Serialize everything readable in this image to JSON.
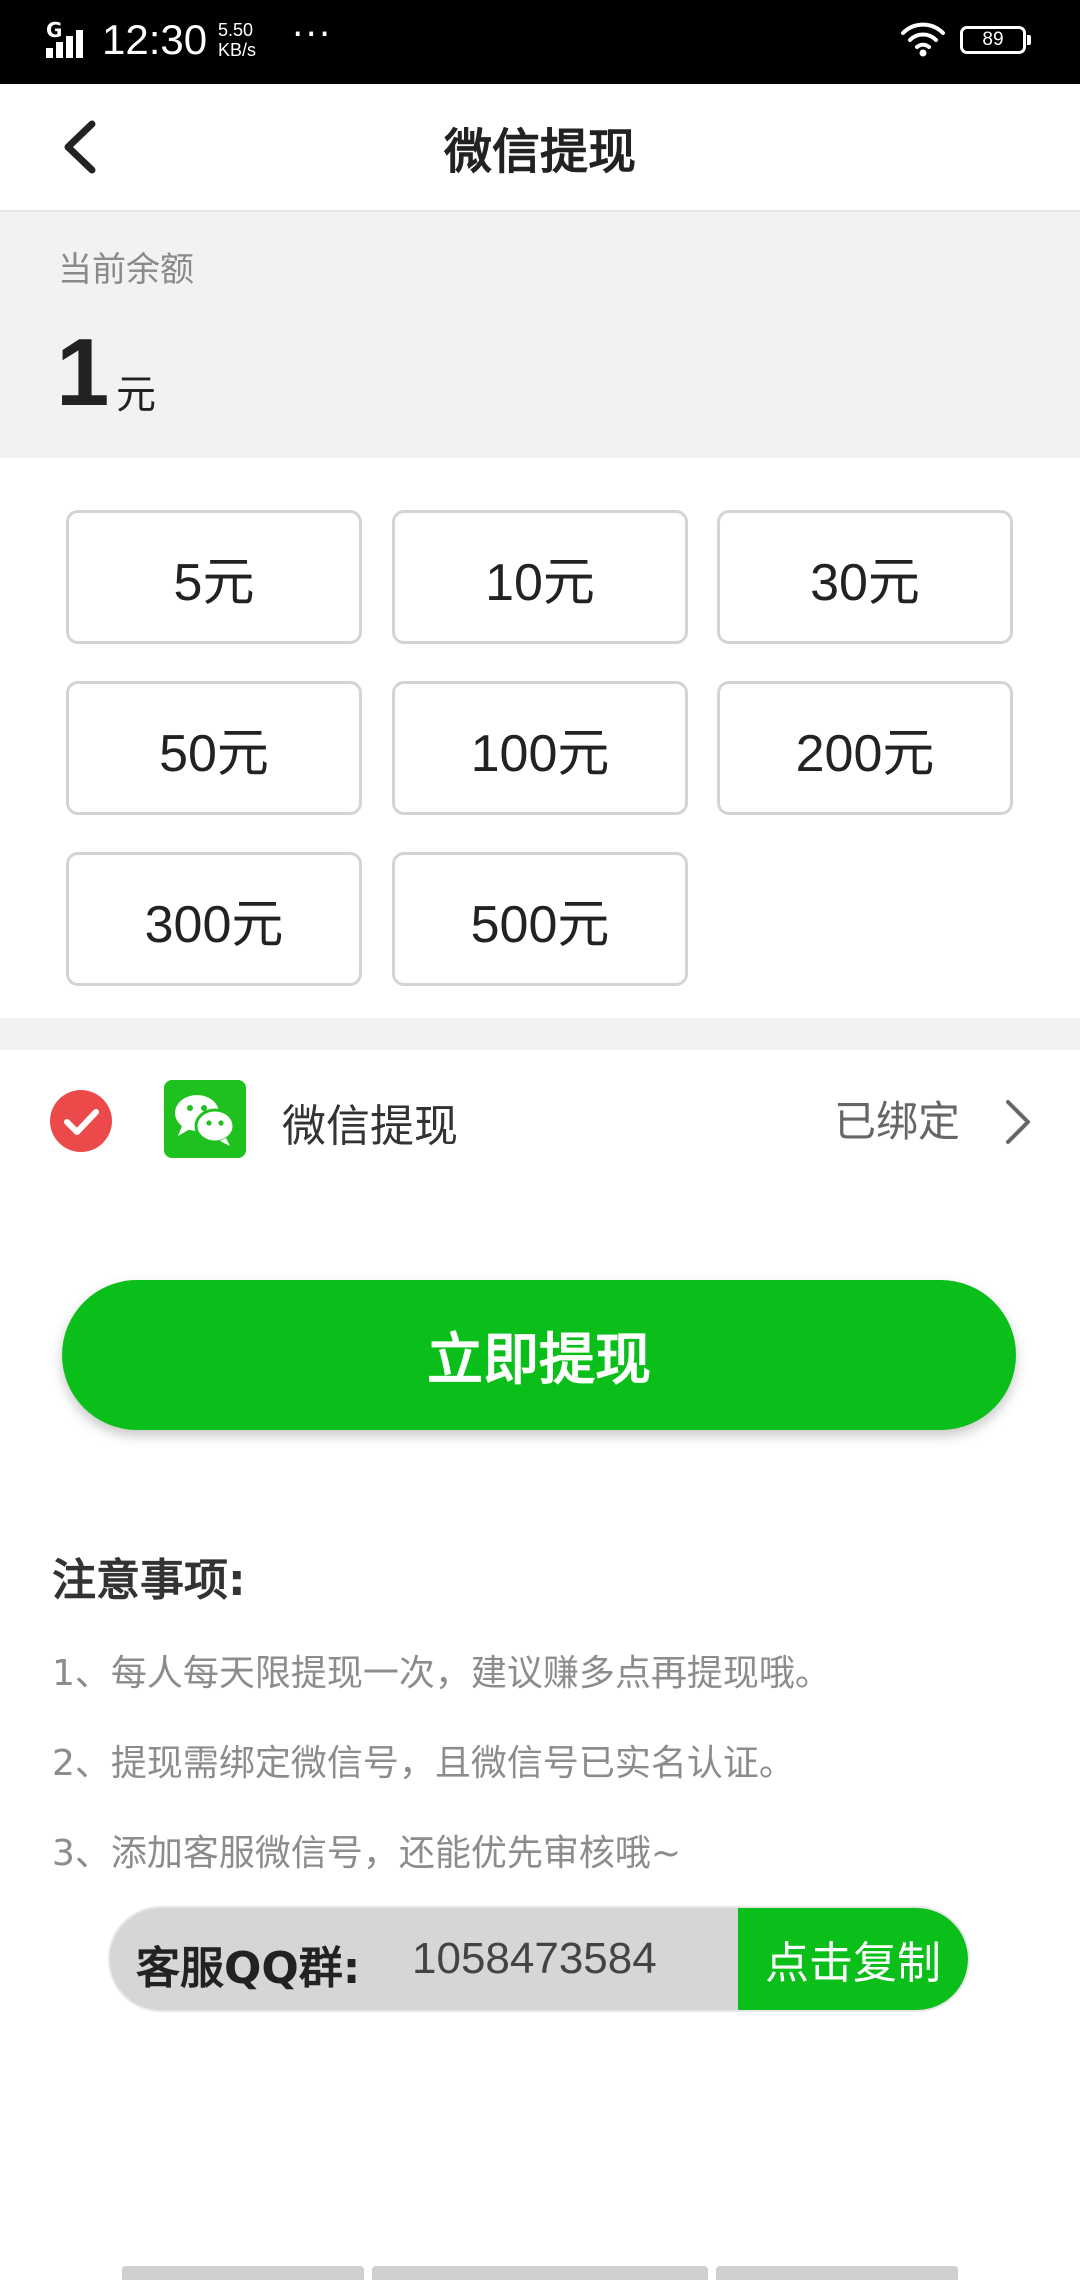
{
  "status_bar": {
    "network": "G",
    "time": "12:30",
    "speed_value": "5.50",
    "speed_unit": "KB/s",
    "more": "···",
    "battery": "89"
  },
  "header": {
    "title": "微信提现",
    "back_icon": "chevron-left-icon"
  },
  "balance": {
    "label": "当前余额",
    "value": "1",
    "unit": "元"
  },
  "amounts": [
    "5元",
    "10元",
    "30元",
    "50元",
    "100元",
    "200元",
    "300元",
    "500元"
  ],
  "method": {
    "check_icon": "check-circle-icon",
    "app_icon": "wechat-icon",
    "label": "微信提现",
    "status": "已绑定"
  },
  "withdraw_button": "立即提现",
  "notice": {
    "title": "注意事项:",
    "items": [
      "1、每人每天限提现一次，建议赚多点再提现哦。",
      "2、提现需绑定微信号，且微信号已实名认证。",
      "3、添加客服微信号，还能优先审核哦~"
    ]
  },
  "qq_group": {
    "label": "客服QQ群:",
    "number": "1058473584",
    "copy_button": "点击复制"
  },
  "colors": {
    "accent_green": "#0bbf1b",
    "check_red": "#ec4a4a",
    "wechat_green": "#1ec11e"
  }
}
